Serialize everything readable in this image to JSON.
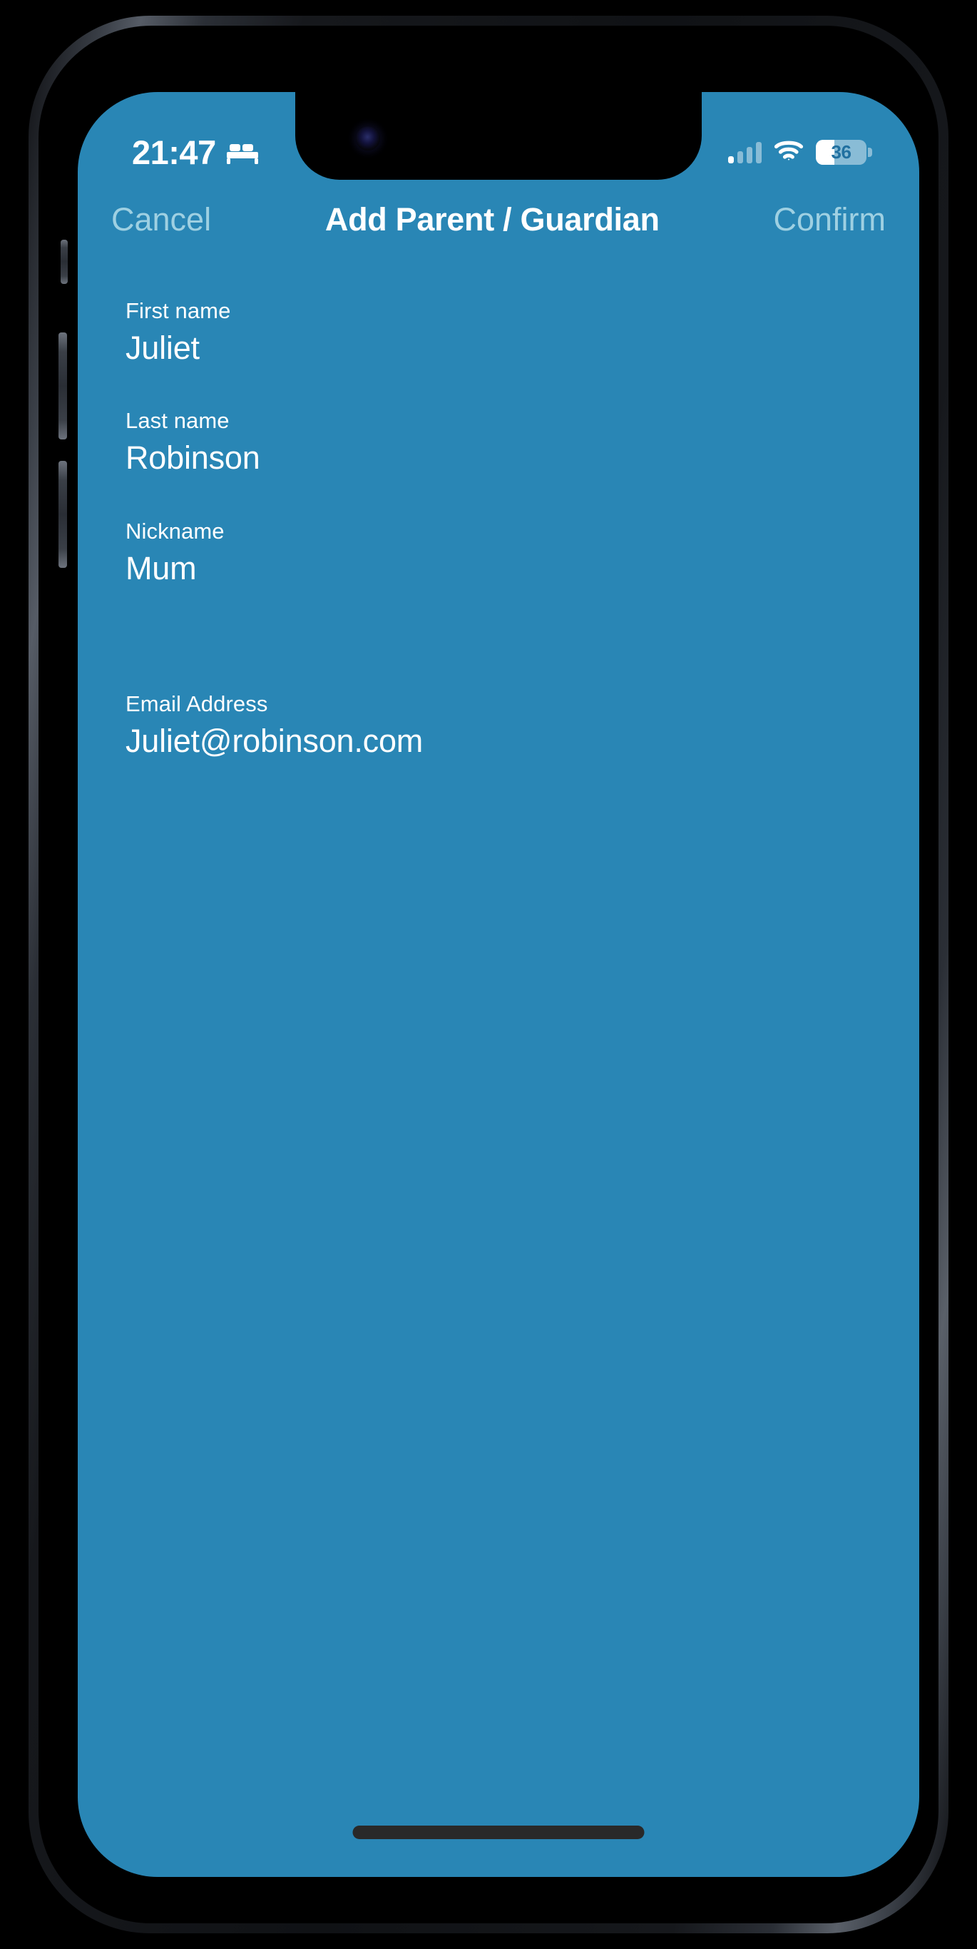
{
  "colors": {
    "app_background": "#2986B5",
    "nav_action": "#9ED0E2",
    "text": "#FFFFFF",
    "home_indicator": "#292929"
  },
  "status_bar": {
    "time": "21:47",
    "focus_icon": "bed-icon",
    "cellular_icon": "signal-bars-icon",
    "wifi_icon": "wifi-icon",
    "battery_icon": "battery-icon",
    "battery_level": "36",
    "battery_percent_fill": 36
  },
  "nav_bar": {
    "cancel_label": "Cancel",
    "title": "Add Parent / Guardian",
    "confirm_label": "Confirm"
  },
  "form": {
    "fields": [
      {
        "label": "First name",
        "value": "Juliet"
      },
      {
        "label": "Last name",
        "value": "Robinson"
      },
      {
        "label": "Nickname",
        "value": "Mum"
      },
      {
        "label": "Email Address",
        "value": "Juliet@robinson.com"
      }
    ]
  }
}
